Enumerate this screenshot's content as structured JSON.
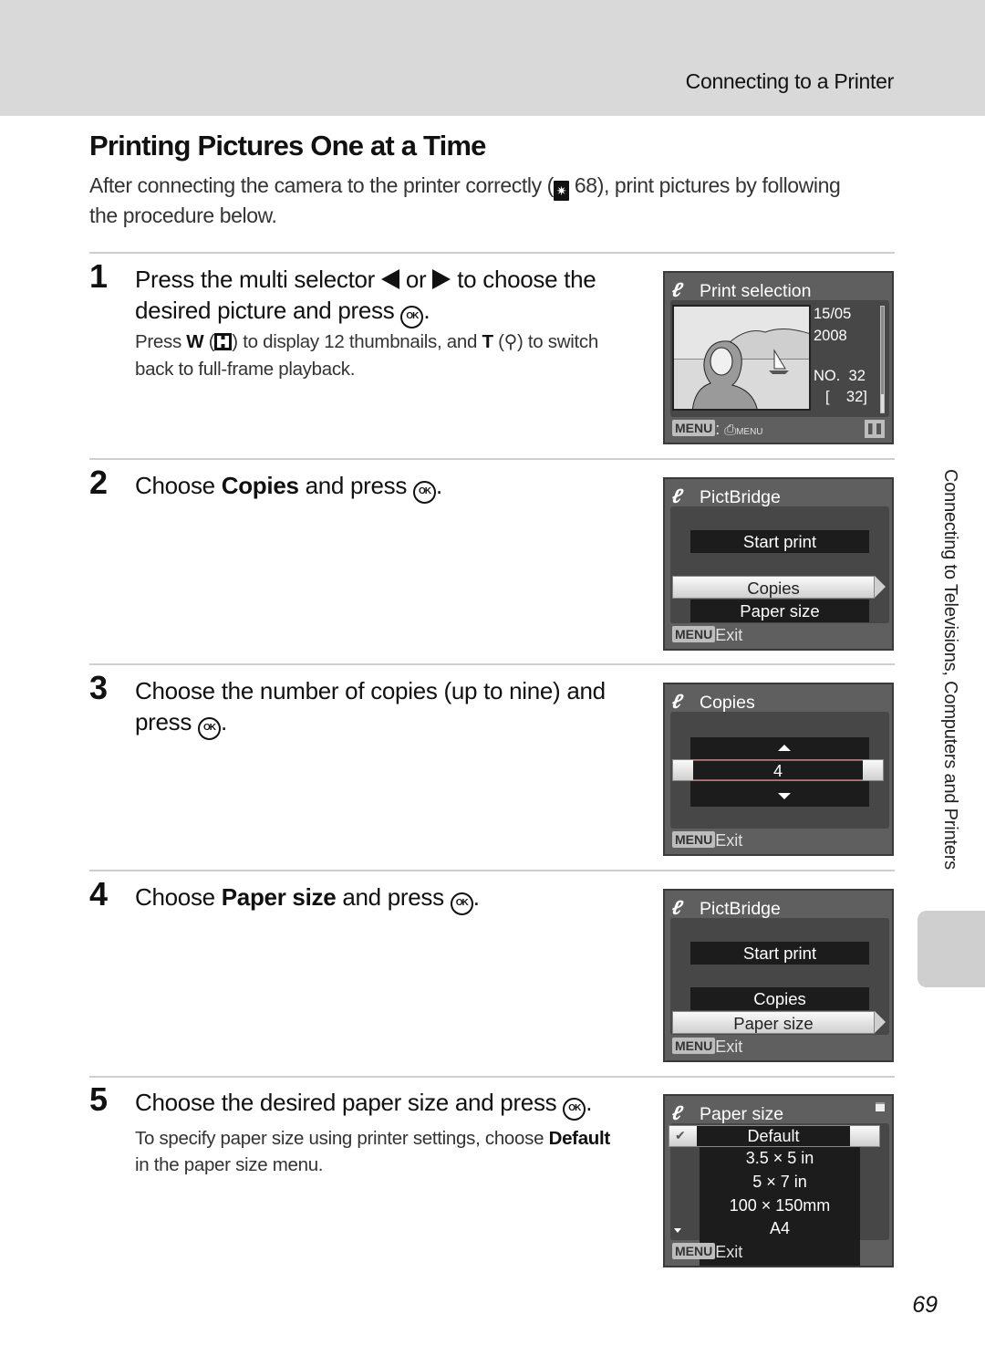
{
  "header": {
    "section_title": "Connecting to a Printer"
  },
  "page": {
    "title": "Printing Pictures One at a Time",
    "intro_before": "After connecting the camera to the printer correctly (",
    "intro_ref_icon": "reference-icon",
    "intro_ref_page": " 68), print pictures by following the procedure below.",
    "page_number": "69",
    "side_label": "Connecting to Televisions, Computers and Printers"
  },
  "steps": [
    {
      "number": "1",
      "text_a": "Press the multi selector ",
      "text_b": " or ",
      "text_c": " to choose the desired picture and press ",
      "text_d": ".",
      "note_a": "Press ",
      "note_w": "W",
      "note_b": " (",
      "note_c": ") to display 12 thumbnails, and ",
      "note_t": "T",
      "note_d": " (",
      "note_e": ") to switch back to full-frame playback."
    },
    {
      "number": "2",
      "text_a": "Choose ",
      "text_bold": "Copies",
      "text_b": " and press ",
      "text_c": "."
    },
    {
      "number": "3",
      "text_a": "Choose the number of copies (up to nine) and press ",
      "text_b": "."
    },
    {
      "number": "4",
      "text_a": "Choose ",
      "text_bold": "Paper size",
      "text_b": " and press ",
      "text_c": "."
    },
    {
      "number": "5",
      "text_a": "Choose the desired paper size and press ",
      "text_b": ".",
      "note_a": "To specify paper size using printer settings, choose ",
      "note_bold": "Default",
      "note_b": " in the paper size menu."
    }
  ],
  "icons": {
    "ok": "OK",
    "zoom": "⚲",
    "pictbridge": "ℓ"
  },
  "screens": {
    "print_selection": {
      "title": "Print selection",
      "date": "15/05",
      "year": "2008",
      "no_label": "NO.",
      "no_value": "32",
      "total": "[    32]",
      "menu_badge": "MENU",
      "footer_suffix": ": ",
      "footer_icon_label": "MENU"
    },
    "pictbridge_copies": {
      "title": "PictBridge",
      "items": [
        "Start print",
        "Copies",
        "Paper size"
      ],
      "selected": "Copies",
      "menu_badge": "MENU",
      "footer": "Exit"
    },
    "copies": {
      "title": "Copies",
      "value": "4",
      "menu_badge": "MENU",
      "footer": "Exit"
    },
    "pictbridge_paper": {
      "title": "PictBridge",
      "items": [
        "Start print",
        "Copies",
        "Paper size"
      ],
      "selected": "Paper size",
      "menu_badge": "MENU",
      "footer": "Exit"
    },
    "paper_size": {
      "title": "Paper size",
      "options": [
        "Default",
        "3.5 × 5 in",
        "5 × 7 in",
        "100 × 150mm",
        "A4"
      ],
      "selected": "Default",
      "menu_badge": "MENU",
      "footer": "Exit"
    }
  }
}
